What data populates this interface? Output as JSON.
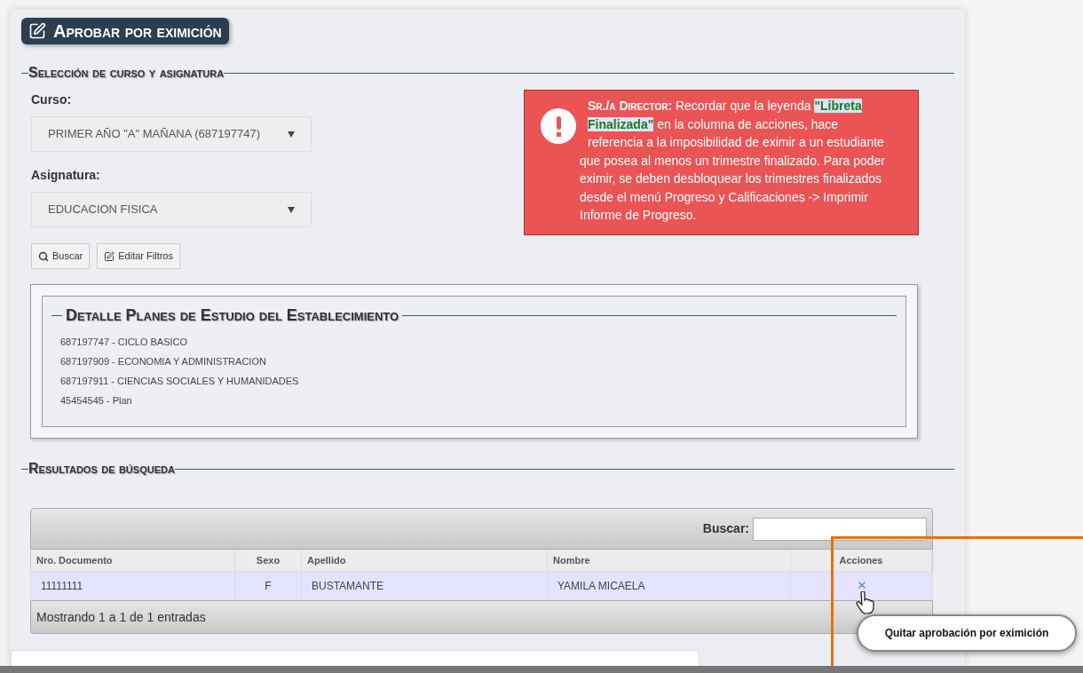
{
  "page_title": "Aprobar por eximición",
  "selection": {
    "legend": "Selección de curso y asignatura",
    "fields": [
      {
        "label": "Curso:",
        "value": "PRIMER AÑO \"A\" MAÑANA (687197747)"
      },
      {
        "label": "Asignatura:",
        "value": "EDUCACION FISICA"
      }
    ],
    "buttons": [
      {
        "kind": "search",
        "label": "Buscar"
      },
      {
        "kind": "edit",
        "label": "Editar Filtros"
      }
    ]
  },
  "alert": {
    "lead": "Sr./a Director:",
    "before": "Recordar que la leyenda",
    "highlight": "\"Libreta Finalizada\"",
    "after": "en la columna de acciones, hace referencia a la imposibilidad de eximir a un estudiante que posea al menos un trimestre finalizado. Para poder eximir, se deben desbloquear los trimestres finalizados desde el menú Progreso y Calificaciones -> Imprimir Informe de Progreso."
  },
  "plans": {
    "legend": "Detalle Planes de Estudio del Establecimiento",
    "items": [
      "687197747 - CICLO BASICO",
      "687197909 - ECONOMIA Y ADMINISTRACION",
      "687197911 - CIENCIAS SOCIALES Y HUMANIDADES",
      "45454545 - Plan"
    ]
  },
  "results": {
    "legend": "Resultados de búsqueda",
    "search_label": "Buscar:",
    "columns": [
      "Nro. Documento",
      "Sexo",
      "Apellido",
      "Nombre",
      "Acciones"
    ],
    "rows": [
      {
        "cells": [
          "11111111",
          "F",
          "BUSTAMANTE",
          "YAMILA MICAELA"
        ],
        "removable": true
      }
    ],
    "info": "Mostrando 1 a 1 de 1 entradas"
  },
  "tooltip": "Quitar aprobación por eximición"
}
